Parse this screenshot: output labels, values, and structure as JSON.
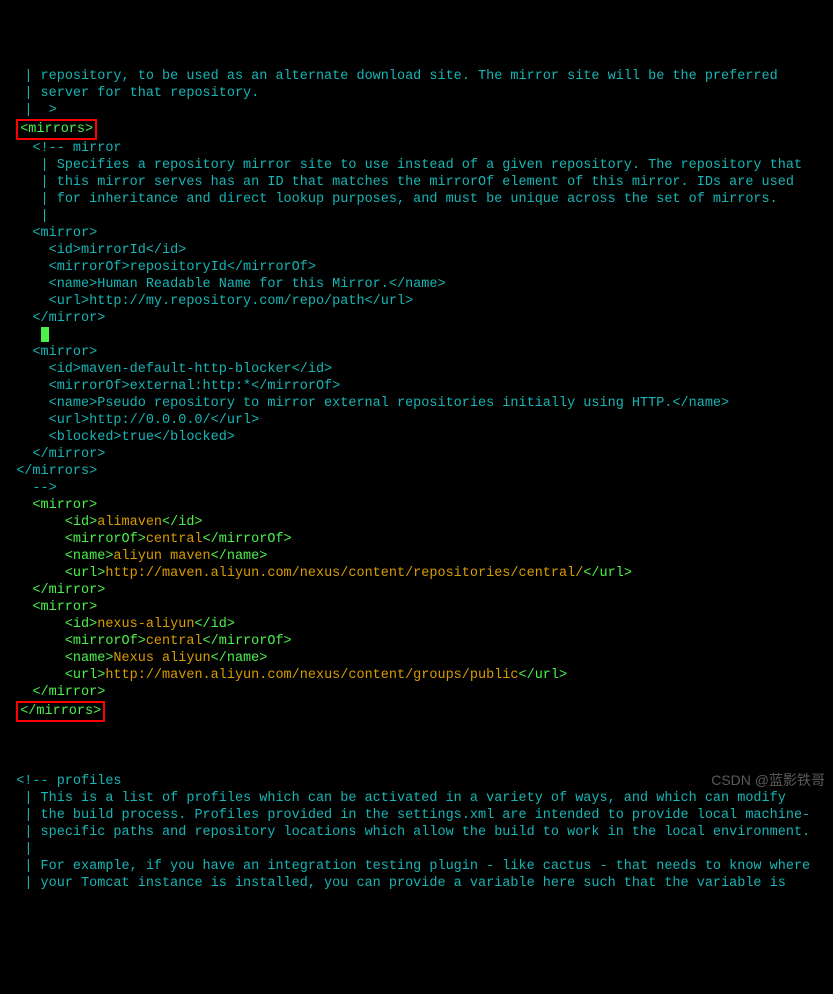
{
  "lines": [
    {
      "indent": "   ",
      "parts": [
        {
          "t": "| repository, to be used as an alternate download site. The mirror site will be the preferred",
          "c": "comment"
        }
      ]
    },
    {
      "indent": "   ",
      "parts": [
        {
          "t": "| server for that repository.",
          "c": "comment"
        }
      ]
    },
    {
      "indent": "   ",
      "parts": [
        {
          "t": "|  >",
          "c": "comment"
        }
      ]
    },
    {
      "indent": "  ",
      "redbox": true,
      "parts": [
        {
          "t": "<mirrors>",
          "c": "green"
        }
      ]
    },
    {
      "indent": "    ",
      "parts": [
        {
          "t": "<!-- mirror",
          "c": "comment"
        }
      ]
    },
    {
      "indent": "     ",
      "parts": [
        {
          "t": "| Specifies a repository mirror site to use instead of a given repository. The repository that",
          "c": "comment"
        }
      ]
    },
    {
      "indent": "     ",
      "parts": [
        {
          "t": "| this mirror serves has an ID that matches the mirrorOf element of this mirror. IDs are used",
          "c": "comment"
        }
      ]
    },
    {
      "indent": "     ",
      "parts": [
        {
          "t": "| for inheritance and direct lookup purposes, and must be unique across the set of mirrors.",
          "c": "comment"
        }
      ]
    },
    {
      "indent": "     ",
      "parts": [
        {
          "t": "|",
          "c": "comment"
        }
      ]
    },
    {
      "indent": "    ",
      "parts": [
        {
          "t": "<mirror>",
          "c": "comment"
        }
      ]
    },
    {
      "indent": "      ",
      "parts": [
        {
          "t": "<id>mirrorId</id>",
          "c": "comment"
        }
      ]
    },
    {
      "indent": "      ",
      "parts": [
        {
          "t": "<mirrorOf>repositoryId</mirrorOf>",
          "c": "comment"
        }
      ]
    },
    {
      "indent": "      ",
      "parts": [
        {
          "t": "<name>Human Readable Name for this Mirror.</name>",
          "c": "comment"
        }
      ]
    },
    {
      "indent": "      ",
      "parts": [
        {
          "t": "<url>http://my.repository.com/repo/path</url>",
          "c": "comment"
        }
      ]
    },
    {
      "indent": "    ",
      "parts": [
        {
          "t": "</mirror>",
          "c": "comment"
        }
      ]
    },
    {
      "indent": "     ",
      "cursor": true,
      "parts": []
    },
    {
      "indent": "    ",
      "parts": [
        {
          "t": "<mirror>",
          "c": "comment"
        }
      ]
    },
    {
      "indent": "      ",
      "parts": [
        {
          "t": "<id>maven-default-http-blocker</id>",
          "c": "comment"
        }
      ]
    },
    {
      "indent": "      ",
      "parts": [
        {
          "t": "<mirrorOf>external:http:*</mirrorOf>",
          "c": "comment"
        }
      ]
    },
    {
      "indent": "      ",
      "parts": [
        {
          "t": "<name>Pseudo repository to mirror external repositories initially using HTTP.</name>",
          "c": "comment"
        }
      ]
    },
    {
      "indent": "      ",
      "parts": [
        {
          "t": "<url>http://0.0.0.0/</url>",
          "c": "comment"
        }
      ]
    },
    {
      "indent": "      ",
      "parts": [
        {
          "t": "<blocked>true</blocked>",
          "c": "comment"
        }
      ]
    },
    {
      "indent": "    ",
      "parts": [
        {
          "t": "</mirror>",
          "c": "comment"
        }
      ]
    },
    {
      "indent": "  ",
      "parts": [
        {
          "t": "</mirrors>",
          "c": "comment"
        }
      ]
    },
    {
      "indent": "    ",
      "parts": [
        {
          "t": "-->",
          "c": "comment"
        }
      ]
    },
    {
      "indent": "    ",
      "parts": [
        {
          "t": "<mirror>",
          "c": "green"
        }
      ]
    },
    {
      "indent": "        ",
      "parts": [
        {
          "t": "<id>",
          "c": "green"
        },
        {
          "t": "alimaven",
          "c": "orange"
        },
        {
          "t": "</id>",
          "c": "green"
        }
      ]
    },
    {
      "indent": "        ",
      "parts": [
        {
          "t": "<mirrorOf>",
          "c": "green"
        },
        {
          "t": "central",
          "c": "orange"
        },
        {
          "t": "</mirrorOf>",
          "c": "green"
        }
      ]
    },
    {
      "indent": "        ",
      "parts": [
        {
          "t": "<name>",
          "c": "green"
        },
        {
          "t": "aliyun maven",
          "c": "orange"
        },
        {
          "t": "</name>",
          "c": "green"
        }
      ]
    },
    {
      "indent": "        ",
      "parts": [
        {
          "t": "<url>",
          "c": "green"
        },
        {
          "t": "http://maven.aliyun.com/nexus/content/repositories/central/",
          "c": "orange"
        },
        {
          "t": "</url>",
          "c": "green"
        }
      ]
    },
    {
      "indent": "    ",
      "parts": [
        {
          "t": "</mirror>",
          "c": "green"
        }
      ]
    },
    {
      "indent": "    ",
      "parts": [
        {
          "t": "<mirror>",
          "c": "green"
        }
      ]
    },
    {
      "indent": "        ",
      "parts": [
        {
          "t": "<id>",
          "c": "green"
        },
        {
          "t": "nexus-aliyun",
          "c": "orange"
        },
        {
          "t": "</id>",
          "c": "green"
        }
      ]
    },
    {
      "indent": "        ",
      "parts": [
        {
          "t": "<mirrorOf>",
          "c": "green"
        },
        {
          "t": "central",
          "c": "orange"
        },
        {
          "t": "</mirrorOf>",
          "c": "green"
        }
      ]
    },
    {
      "indent": "        ",
      "parts": [
        {
          "t": "<name>",
          "c": "green"
        },
        {
          "t": "Nexus aliyun",
          "c": "orange"
        },
        {
          "t": "</name>",
          "c": "green"
        }
      ]
    },
    {
      "indent": "        ",
      "parts": [
        {
          "t": "<url>",
          "c": "green"
        },
        {
          "t": "http://maven.aliyun.com/nexus/content/groups/public",
          "c": "orange"
        },
        {
          "t": "</url>",
          "c": "green"
        }
      ]
    },
    {
      "indent": "    ",
      "parts": [
        {
          "t": "</mirror>",
          "c": "green"
        }
      ]
    },
    {
      "indent": "  ",
      "redbox": true,
      "parts": [
        {
          "t": "</mirrors>",
          "c": "green"
        }
      ]
    },
    {
      "indent": "",
      "parts": [
        {
          "t": " ",
          "c": "comment"
        }
      ]
    },
    {
      "indent": "",
      "parts": [
        {
          "t": " ",
          "c": "comment"
        }
      ]
    },
    {
      "indent": "",
      "parts": [
        {
          "t": " ",
          "c": "comment"
        }
      ]
    },
    {
      "indent": "  ",
      "parts": [
        {
          "t": "<!-- profiles",
          "c": "comment"
        }
      ]
    },
    {
      "indent": "   ",
      "parts": [
        {
          "t": "| This is a list of profiles which can be activated in a variety of ways, and which can modify",
          "c": "comment"
        }
      ]
    },
    {
      "indent": "   ",
      "parts": [
        {
          "t": "| the build process. Profiles provided in the settings.xml are intended to provide local machine-",
          "c": "comment"
        }
      ]
    },
    {
      "indent": "   ",
      "parts": [
        {
          "t": "| specific paths and repository locations which allow the build to work in the local environment.",
          "c": "comment"
        }
      ]
    },
    {
      "indent": "   ",
      "parts": [
        {
          "t": "|",
          "c": "comment"
        }
      ]
    },
    {
      "indent": "   ",
      "parts": [
        {
          "t": "| For example, if you have an integration testing plugin - like cactus - that needs to know where",
          "c": "comment"
        }
      ]
    },
    {
      "indent": "   ",
      "parts": [
        {
          "t": "| your Tomcat instance is installed, you can provide a variable here such that the variable is",
          "c": "comment"
        }
      ]
    }
  ],
  "watermark": "CSDN @蓝影铁哥"
}
